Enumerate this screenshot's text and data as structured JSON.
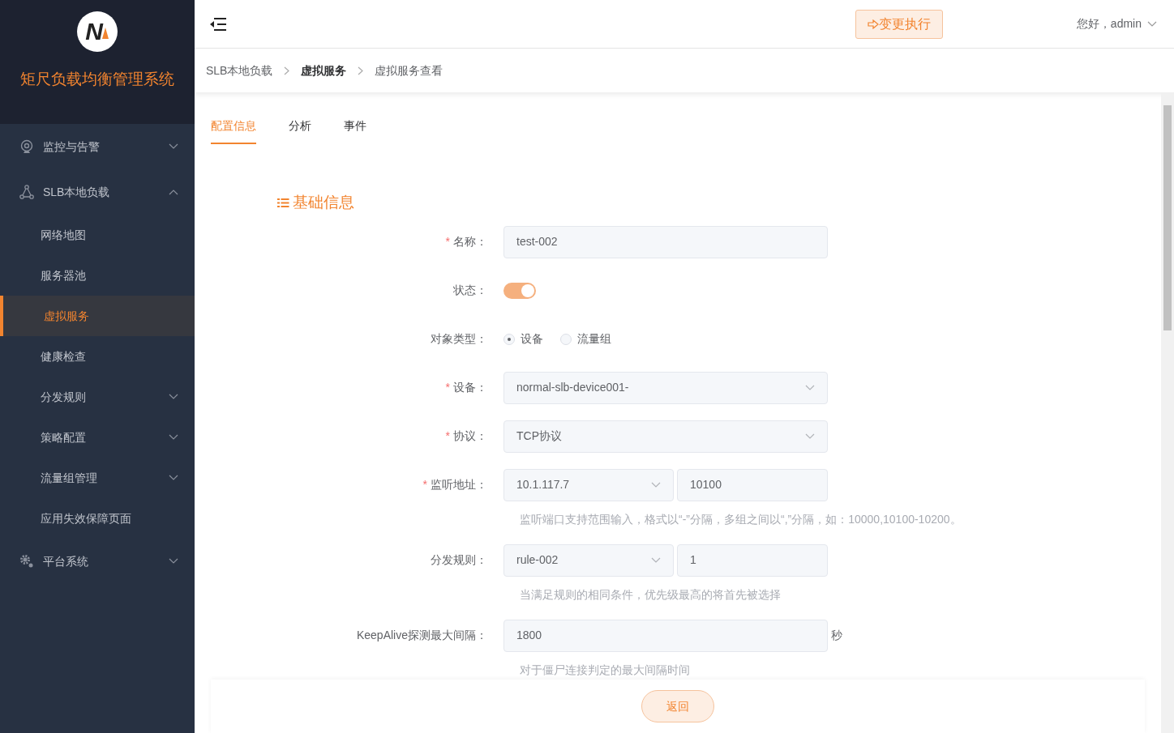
{
  "sidebar": {
    "logo_letter": "N",
    "title": "矩尺负载均衡管理系统",
    "items": [
      {
        "label": "监控与告警",
        "expanded": false
      },
      {
        "label": "SLB本地负载",
        "expanded": true,
        "children": [
          {
            "label": "网络地图",
            "selected": false
          },
          {
            "label": "服务器池",
            "selected": false
          },
          {
            "label": "虚拟服务",
            "selected": true
          },
          {
            "label": "健康检查",
            "selected": false
          },
          {
            "label": "分发规则",
            "selected": false,
            "expanded": false
          },
          {
            "label": "策略配置",
            "selected": false,
            "expanded": false
          },
          {
            "label": "流量组管理",
            "selected": false,
            "expanded": false
          },
          {
            "label": "应用失效保障页面",
            "selected": false
          }
        ]
      },
      {
        "label": "平台系统",
        "expanded": false
      }
    ]
  },
  "header": {
    "action_button": "变更执行",
    "greeting": "您好，admin"
  },
  "breadcrumb": [
    {
      "label": "SLB本地负载",
      "emphasized": false
    },
    {
      "label": "虚拟服务",
      "emphasized": true
    },
    {
      "label": "虚拟服务查看",
      "emphasized": false
    }
  ],
  "tabs": [
    {
      "label": "配置信息",
      "selected": true
    },
    {
      "label": "分析",
      "selected": false
    },
    {
      "label": "事件",
      "selected": false
    }
  ],
  "section_title": "基础信息",
  "form": [
    {
      "kind": "input",
      "required_mark": "*",
      "label": "名称：",
      "value": "test-002"
    },
    {
      "kind": "switch",
      "label": "状态：",
      "on": true
    },
    {
      "kind": "radio",
      "label": "对象类型：",
      "options": [
        {
          "label": "设备",
          "selected": true
        },
        {
          "label": "流量组",
          "selected": false
        }
      ]
    },
    {
      "kind": "select",
      "required_mark": "*",
      "label": "设备：",
      "value": "normal-slb-device001-"
    },
    {
      "kind": "select",
      "required_mark": "*",
      "label": "协议：",
      "value": "TCP协议"
    },
    {
      "kind": "select_input",
      "required_mark": "*",
      "label": "监听地址：",
      "value": "10.1.117.7",
      "second_value": "10100",
      "hint": "监听端口支持范围输入，格式以“-”分隔，多组之间以“,”分隔，如：10000,10100-10200。"
    },
    {
      "kind": "select_input",
      "label": "分发规则：",
      "value": "rule-002",
      "second_value": "1",
      "hint": "当满足规则的相同条件，优先级最高的将首先被选择"
    },
    {
      "kind": "input",
      "label": "KeepAlive探测最大间隔：",
      "value": "1800",
      "unit": "秒",
      "hint": "对于僵尸连接判定的最大间隔时间"
    }
  ],
  "footer": {
    "back_button": "返回"
  }
}
